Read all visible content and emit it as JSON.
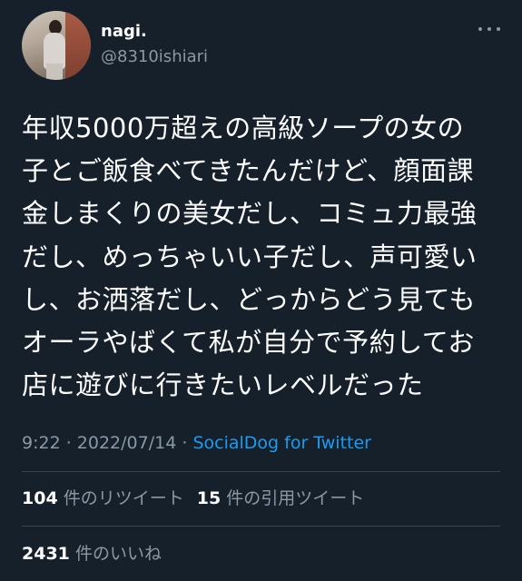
{
  "author": {
    "name": "nagi.",
    "handle": "@8310ishiari"
  },
  "tweet": {
    "lines": [
      "年収5000万超えの高級ソープの女の",
      "子とご飯食べてきたんだけど、顔面課",
      "金しまくりの美女だし、コミュ力最強",
      "だし、めっちゃいい子だし、声可愛い",
      "し、お洒落だし、どっからどう見ても",
      "オーラやばくて私が自分で予約してお",
      "店に遊びに行きたいレベルだった"
    ]
  },
  "meta": {
    "time": "9:22",
    "separator1": " · ",
    "date": "2022/07/14",
    "separator2": " · ",
    "source": "SocialDog for Twitter"
  },
  "stats": {
    "retweets_count": "104",
    "retweets_label": "件のリツイート",
    "quotes_count": "15",
    "quotes_label": "件の引用ツイート",
    "likes_count": "2431",
    "likes_label": "件のいいね"
  },
  "colors": {
    "background": "#15202b",
    "text": "#ffffff",
    "secondary_text": "#8b98a5",
    "link": "#1d9bf0",
    "divider": "#38444d"
  },
  "icons": {
    "more": "more-dots-icon"
  }
}
